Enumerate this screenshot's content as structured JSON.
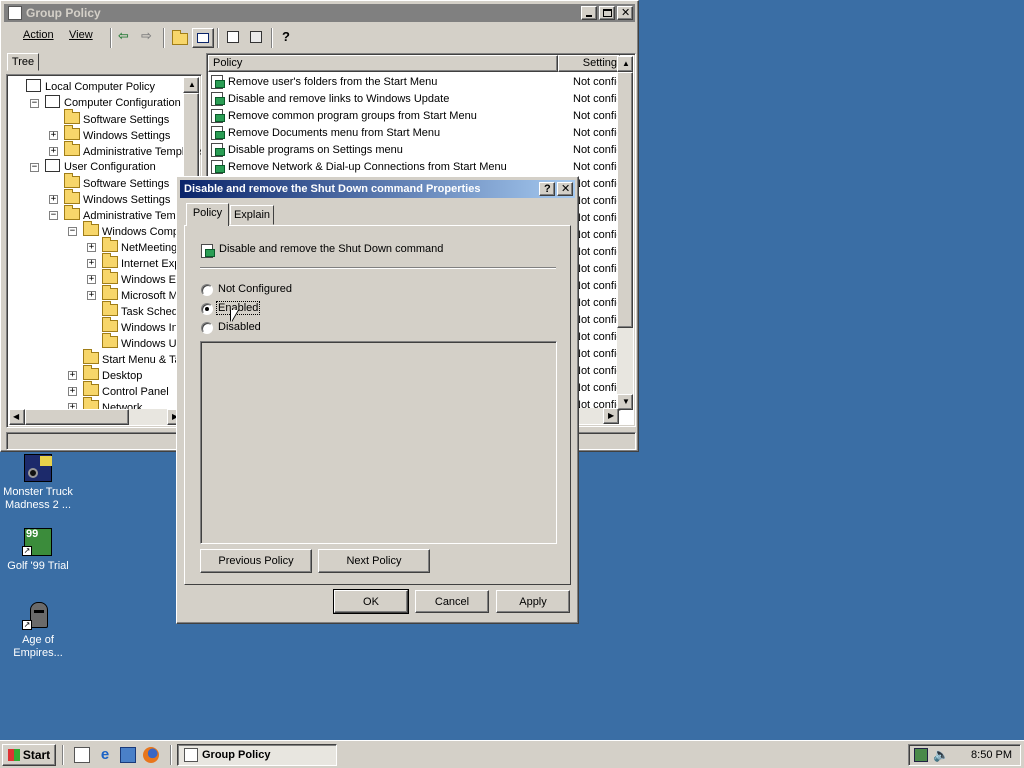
{
  "gp_window": {
    "title": "Group Policy",
    "menu": {
      "action": "Action",
      "view": "View"
    },
    "tree_tab": "Tree",
    "tree": [
      {
        "label": "Local Computer Policy",
        "depth": 0,
        "expander": "",
        "icon": "computer-policy-icon"
      },
      {
        "label": "Computer Configuration",
        "depth": 1,
        "expander": "−",
        "icon": "computer-icon"
      },
      {
        "label": "Software Settings",
        "depth": 2,
        "expander": "",
        "icon": "folder-icon"
      },
      {
        "label": "Windows Settings",
        "depth": 2,
        "expander": "+",
        "icon": "folder-icon"
      },
      {
        "label": "Administrative Templates",
        "depth": 2,
        "expander": "+",
        "icon": "folder-icon"
      },
      {
        "label": "User Configuration",
        "depth": 1,
        "expander": "−",
        "icon": "user-icon"
      },
      {
        "label": "Software Settings",
        "depth": 2,
        "expander": "",
        "icon": "folder-icon"
      },
      {
        "label": "Windows Settings",
        "depth": 2,
        "expander": "+",
        "icon": "folder-icon"
      },
      {
        "label": "Administrative Templates",
        "depth": 2,
        "expander": "−",
        "icon": "folder-icon"
      },
      {
        "label": "Windows Components",
        "depth": 3,
        "expander": "−",
        "icon": "folder-icon"
      },
      {
        "label": "NetMeeting",
        "depth": 4,
        "expander": "+",
        "icon": "folder-icon"
      },
      {
        "label": "Internet Explorer",
        "depth": 4,
        "expander": "+",
        "icon": "folder-icon"
      },
      {
        "label": "Windows Explorer",
        "depth": 4,
        "expander": "+",
        "icon": "folder-icon"
      },
      {
        "label": "Microsoft Management Console",
        "depth": 4,
        "expander": "+",
        "icon": "folder-icon"
      },
      {
        "label": "Task Scheduler",
        "depth": 4,
        "expander": "",
        "icon": "folder-icon"
      },
      {
        "label": "Windows Installer",
        "depth": 4,
        "expander": "",
        "icon": "folder-icon"
      },
      {
        "label": "Windows Update",
        "depth": 4,
        "expander": "",
        "icon": "folder-icon"
      },
      {
        "label": "Start Menu & Taskbar",
        "depth": 3,
        "expander": "",
        "icon": "folder-icon"
      },
      {
        "label": "Desktop",
        "depth": 3,
        "expander": "+",
        "icon": "folder-icon"
      },
      {
        "label": "Control Panel",
        "depth": 3,
        "expander": "+",
        "icon": "folder-icon"
      },
      {
        "label": "Network",
        "depth": 3,
        "expander": "+",
        "icon": "folder-icon"
      }
    ],
    "columns": {
      "policy": "Policy",
      "setting": "Setting"
    },
    "policies": [
      {
        "name": "Remove user's folders from the Start Menu",
        "state": "Not configured"
      },
      {
        "name": "Disable and remove links to Windows Update",
        "state": "Not configured"
      },
      {
        "name": "Remove common program groups from Start Menu",
        "state": "Not configured"
      },
      {
        "name": "Remove Documents menu from Start Menu",
        "state": "Not configured"
      },
      {
        "name": "Disable programs on Settings menu",
        "state": "Not configured"
      },
      {
        "name": "Remove Network & Dial-up Connections from Start Menu",
        "state": "Not configured"
      },
      {
        "name": "",
        "state": "Not configured"
      },
      {
        "name": "",
        "state": "Not configured"
      },
      {
        "name": "",
        "state": "Not configured"
      },
      {
        "name": "",
        "state": "Not configured"
      },
      {
        "name": "",
        "state": "Not configured"
      },
      {
        "name": "",
        "state": "Not configured"
      },
      {
        "name": "",
        "state": "Not configured"
      },
      {
        "name": "",
        "state": "Not configured"
      },
      {
        "name": "",
        "state": "Not configured"
      },
      {
        "name": "",
        "state": "Not configured"
      },
      {
        "name": "",
        "state": "Not configured"
      },
      {
        "name": "",
        "state": "Not configured"
      },
      {
        "name": "",
        "state": "Not configured"
      },
      {
        "name": "",
        "state": "Not configured"
      }
    ]
  },
  "dialog": {
    "title": "Disable and remove the Shut Down command Properties",
    "help": "?",
    "close": "✕",
    "tabs": {
      "policy": "Policy",
      "explain": "Explain"
    },
    "policy_name": "Disable and remove the Shut Down command",
    "options": {
      "not_configured": "Not Configured",
      "enabled": "Enabled",
      "disabled": "Disabled"
    },
    "selected": "enabled",
    "prev_btn": "Previous Policy",
    "next_btn": "Next Policy",
    "ok": "OK",
    "cancel": "Cancel",
    "apply": "Apply"
  },
  "desktop": {
    "icons": [
      {
        "label": "Monster Truck Madness 2 ...",
        "icon": "monster-truck-icon"
      },
      {
        "label": "Golf '99 Trial",
        "icon": "golf-icon"
      },
      {
        "label": "Age of Empires...",
        "icon": "age-of-empires-icon"
      }
    ]
  },
  "taskbar": {
    "start": "Start",
    "task": "Group Policy",
    "clock": "8:50 PM"
  },
  "colors": {
    "desktop": "#3a6ea5",
    "title_active": "#0a246a",
    "title_inactive": "#808080",
    "face": "#d4d0c8"
  }
}
